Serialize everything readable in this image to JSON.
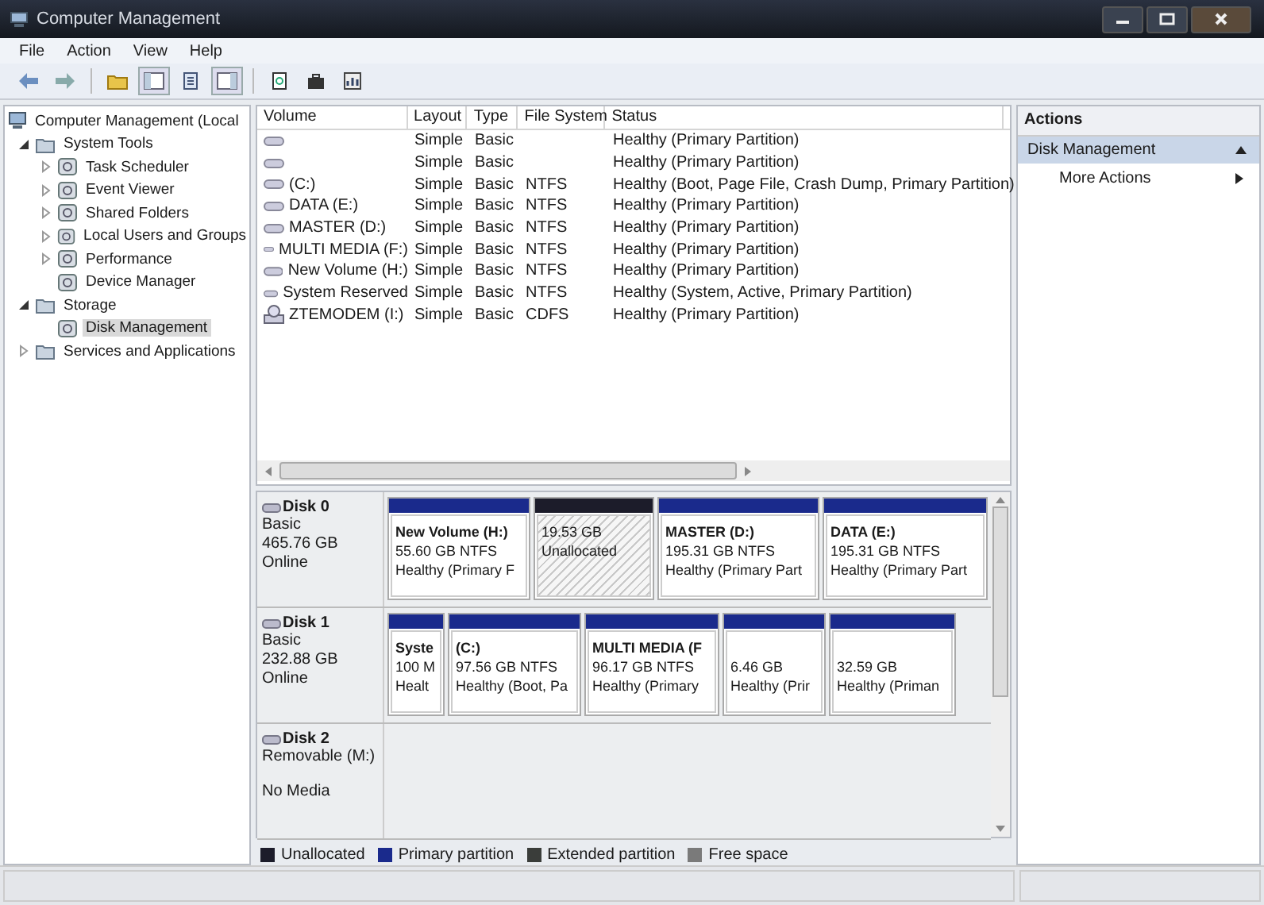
{
  "window": {
    "title": "Computer Management"
  },
  "menu": [
    "File",
    "Action",
    "View",
    "Help"
  ],
  "tree": [
    {
      "label": "Computer Management (Local",
      "selected": false,
      "children": [
        {
          "label": "System Tools",
          "expanded": true,
          "selected": false,
          "children": [
            {
              "label": "Task Scheduler",
              "expanded": false,
              "selected": false
            },
            {
              "label": "Event Viewer",
              "expanded": false,
              "selected": false
            },
            {
              "label": "Shared Folders",
              "expanded": false,
              "selected": false
            },
            {
              "label": "Local Users and Groups",
              "expanded": false,
              "selected": false
            },
            {
              "label": "Performance",
              "expanded": false,
              "selected": false
            },
            {
              "label": "Device Manager",
              "selected": false
            }
          ]
        },
        {
          "label": "Storage",
          "expanded": true,
          "selected": false,
          "children": [
            {
              "label": "Disk Management",
              "selected": true
            }
          ]
        },
        {
          "label": "Services and Applications",
          "expanded": false,
          "selected": false
        }
      ]
    }
  ],
  "table": {
    "columns": [
      "Volume",
      "Layout",
      "Type",
      "File System",
      "Status"
    ],
    "rows": [
      {
        "kind": "disk",
        "cells": [
          "",
          "Simple",
          "Basic",
          "",
          "Healthy (Primary Partition)"
        ]
      },
      {
        "kind": "disk",
        "cells": [
          "",
          "Simple",
          "Basic",
          "",
          "Healthy (Primary Partition)"
        ]
      },
      {
        "kind": "disk",
        "cells": [
          "(C:)",
          "Simple",
          "Basic",
          "NTFS",
          "Healthy (Boot, Page File, Crash Dump, Primary Partition)"
        ]
      },
      {
        "kind": "disk",
        "cells": [
          "DATA (E:)",
          "Simple",
          "Basic",
          "NTFS",
          "Healthy (Primary Partition)"
        ]
      },
      {
        "kind": "disk",
        "cells": [
          "MASTER (D:)",
          "Simple",
          "Basic",
          "NTFS",
          "Healthy (Primary Partition)"
        ]
      },
      {
        "kind": "disk",
        "cells": [
          "MULTI MEDIA (F:)",
          "Simple",
          "Basic",
          "NTFS",
          "Healthy (Primary Partition)"
        ]
      },
      {
        "kind": "disk",
        "cells": [
          "New Volume (H:)",
          "Simple",
          "Basic",
          "NTFS",
          "Healthy (Primary Partition)"
        ]
      },
      {
        "kind": "disk",
        "cells": [
          "System Reserved",
          "Simple",
          "Basic",
          "NTFS",
          "Healthy (System, Active, Primary Partition)"
        ]
      },
      {
        "kind": "cd",
        "cells": [
          "ZTEMODEM (I:)",
          "Simple",
          "Basic",
          "CDFS",
          "Healthy (Primary Partition)"
        ]
      }
    ]
  },
  "disks": [
    {
      "name": "Disk 0",
      "type": "Basic",
      "capacity": "465.76 GB",
      "state": "Online",
      "partitions": [
        {
          "kind": "primary",
          "name": "New Volume  (H:)",
          "size": "55.60 GB NTFS",
          "status": "Healthy (Primary F"
        },
        {
          "kind": "unallocated",
          "name": "19.53 GB",
          "size": "Unallocated"
        },
        {
          "kind": "primary",
          "name": "MASTER  (D:)",
          "size": "195.31 GB NTFS",
          "status": "Healthy (Primary Part"
        },
        {
          "kind": "primary",
          "name": "DATA  (E:)",
          "size": "195.31 GB NTFS",
          "status": "Healthy (Primary Part"
        }
      ]
    },
    {
      "name": "Disk 1",
      "type": "Basic",
      "capacity": "232.88 GB",
      "state": "Online",
      "partitions": [
        {
          "kind": "primary",
          "name": "Syste",
          "size": "100 M",
          "status": "Healt"
        },
        {
          "kind": "primary",
          "name": " (C:)",
          "size": "97.56 GB NTFS",
          "status": "Healthy (Boot, Pa"
        },
        {
          "kind": "primary",
          "name": "MULTI MEDIA  (F",
          "size": "96.17 GB NTFS",
          "status": "Healthy (Primary"
        },
        {
          "kind": "primary",
          "size": "6.46 GB",
          "status": "Healthy (Prir"
        },
        {
          "kind": "primary",
          "size": "32.59 GB",
          "status": "Healthy (Priman"
        }
      ]
    },
    {
      "name": "Disk 2",
      "type": "Removable (M:)",
      "state": "No Media"
    }
  ],
  "legend": [
    {
      "label": "Unallocated",
      "color": "#1c1c2a"
    },
    {
      "label": "Primary partition",
      "color": "#1a2a8c"
    },
    {
      "label": "Extended partition",
      "color": "#3a3d3a"
    },
    {
      "label": "Free space",
      "color": "#7a7a7a"
    }
  ],
  "actions": {
    "title": "Actions",
    "section": "Disk Management",
    "items": [
      "More Actions"
    ]
  }
}
